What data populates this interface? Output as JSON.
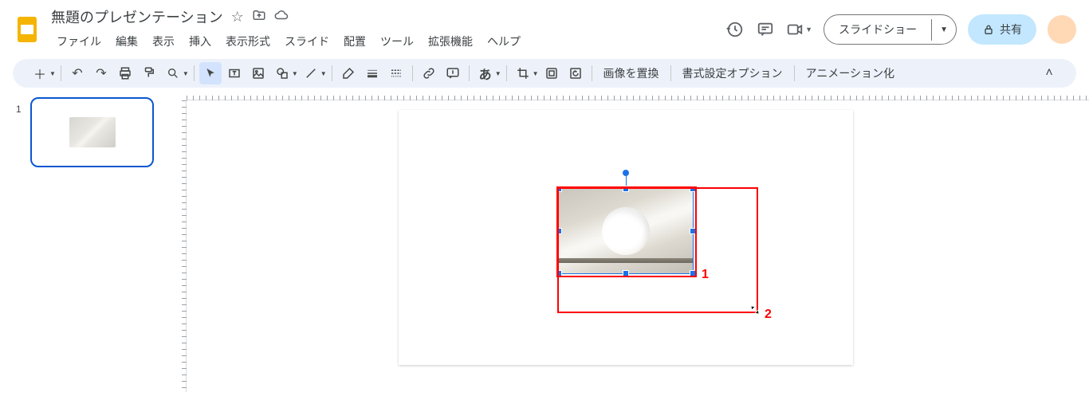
{
  "title": "無題のプレゼンテーション",
  "menus": {
    "file": "ファイル",
    "edit": "編集",
    "view": "表示",
    "insert": "挿入",
    "format": "表示形式",
    "slide": "スライド",
    "arrange": "配置",
    "tools": "ツール",
    "extensions": "拡張機能",
    "help": "ヘルプ"
  },
  "header": {
    "slideshow": "スライドショー",
    "share": "共有"
  },
  "toolbar": {
    "replace_image": "画像を置換",
    "format_options": "書式設定オプション",
    "animation": "アニメーション化",
    "a_char": "あ"
  },
  "sidebar": {
    "slide_num": "1"
  },
  "annotations": {
    "label1": "1",
    "label2": "2"
  }
}
